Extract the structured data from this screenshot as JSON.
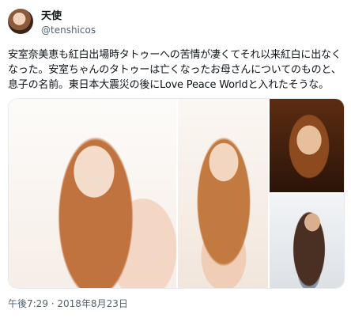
{
  "author": {
    "display_name": "天使",
    "handle": "@tenshicos"
  },
  "tweet": {
    "text": "安室奈美恵も紅白出場時タトゥーへの苦情が凄くてそれ以来紅白に出なくなった。安室ちゃんのタトゥーは亡くなったお母さんについてのものと、息子の名前。東日本大震災の後にLove Peace Worldと入れたそうな。",
    "timestamp": "午後7:29 · 2018年8月23日"
  },
  "media": {
    "photos": [
      {
        "alt": "photo-1"
      },
      {
        "alt": "photo-2"
      },
      {
        "alt": "photo-3"
      },
      {
        "alt": "photo-4"
      }
    ]
  }
}
